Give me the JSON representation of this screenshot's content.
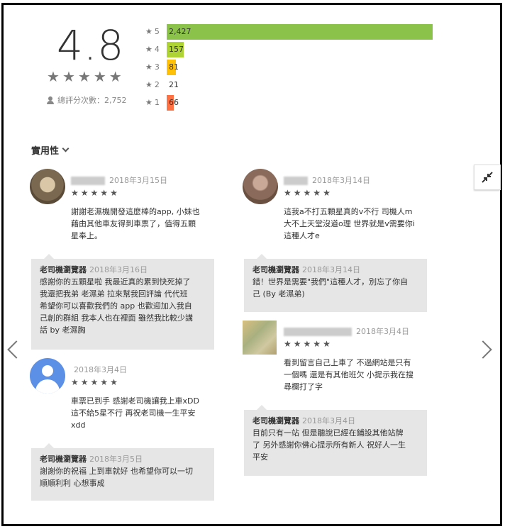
{
  "summary": {
    "rating": "4.8",
    "total_label": "總評分次數：2,752",
    "star_glyph": "★"
  },
  "histogram": [
    {
      "star": "5",
      "count": "2,427",
      "value": 2427,
      "color": "#8bc34a"
    },
    {
      "star": "4",
      "count": "157",
      "value": 157,
      "color": "#aed335"
    },
    {
      "star": "3",
      "count": "81",
      "value": 81,
      "color": "#ffc107"
    },
    {
      "star": "2",
      "count": "21",
      "value": 21,
      "color": "#ff9800"
    },
    {
      "star": "1",
      "count": "66",
      "value": 66,
      "color": "#ff7043"
    }
  ],
  "sort_label": "實用性",
  "reviews": [
    {
      "date": "2018年3月15日",
      "text": [
        "謝謝老濕機開發這麼棒的app, 小妹也",
        "藉由其他車友得到車票了，值得五顆",
        "星奉上。"
      ],
      "reply": {
        "name": "老司機瀏覽器",
        "date": "2018年3月16日",
        "text": [
          "感謝你的五顆星啦 我最近真的累到快死掉了",
          "我還把我弟 老濕弟 拉來幫我回評論 代代班",
          "希望你可以喜歡我們的 app 也歡迎加入我自",
          "己創的群組 我本人也在裡面 雖然我比較少講",
          "話 by 老濕胸"
        ]
      }
    },
    {
      "date": "2018年3月14日",
      "text": [
        "這我a不打五顆星真的v不行 司機人m",
        "大不上天堂沒道o理 世界就是v需要你i",
        "這種人才e"
      ],
      "reply": {
        "name": "老司機瀏覽器",
        "date": "2018年3月14日",
        "text": [
          "錯！世界是需要\"我們\"這種人才，別忘了你自",
          "己 (By 老濕弟)"
        ]
      }
    },
    {
      "date": "2018年3月4日",
      "text": [
        "車票已到手 感謝老司機讓我上車xDD",
        "這不給5星不行 再祝老司機一生平安",
        "xdd"
      ],
      "reply": {
        "name": "老司機瀏覽器",
        "date": "2018年3月5日",
        "text": [
          "謝謝你的祝福 上到車就好 也希望你可以一切",
          "順順利利 心想事成"
        ]
      }
    },
    {
      "date": "2018年3月4日",
      "text": [
        "看到留言自己上車了 不過網站是只有",
        "一個嗎 還是有其他班欠 小提示我在搜",
        "尋欄打了字"
      ],
      "reply": {
        "name": "老司機瀏覽器",
        "date": "2018年3月4日",
        "text": [
          "目前只有一站 但是聽說已經在鋪設其他站牌",
          "了 另外感謝你佛心提示所有新人 祝好人一生",
          "平安"
        ]
      }
    }
  ],
  "icons": {
    "prev": "chevron-left-icon",
    "next": "chevron-right-icon",
    "collapse": "collapse-icon"
  }
}
